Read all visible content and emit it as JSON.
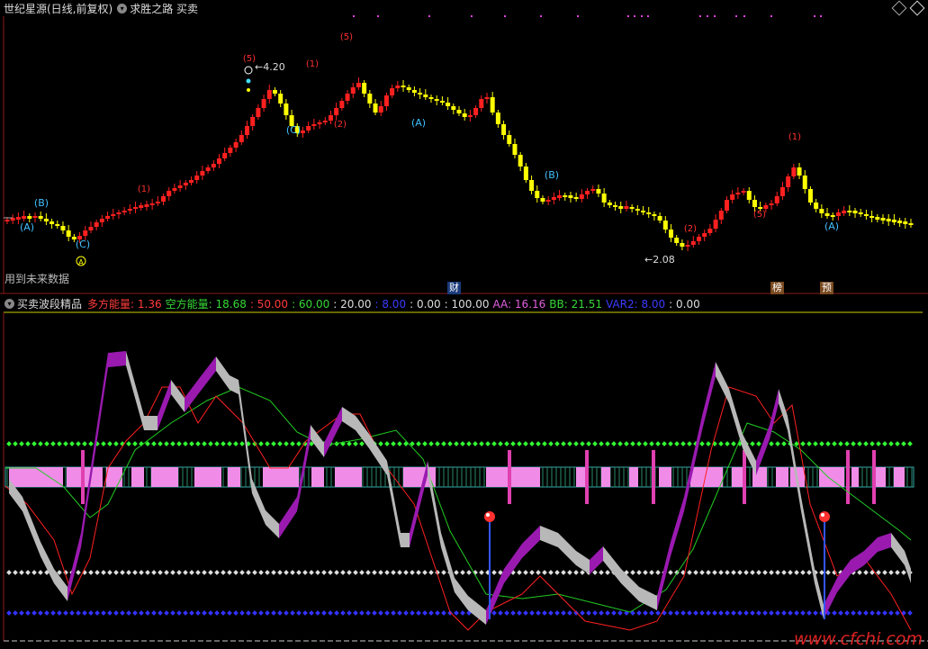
{
  "header": {
    "title": "世纪星源(日线,前复权)",
    "indicator_name": "求胜之路 买卖"
  },
  "price_chart": {
    "high_label": "4.20",
    "low_label": "2.08",
    "future_data_note": "用到未来数据",
    "wave_labels_cyan": [
      "(A)",
      "(B)",
      "(C)",
      "(C)",
      "(A)",
      "(B)",
      "(A)"
    ],
    "wave_labels_red": [
      "(1)",
      "(5)",
      "(1)",
      "(2)",
      "(5)",
      "(1)",
      "(2)",
      "(5)"
    ],
    "event_tags": [
      {
        "text": "财",
        "color": "#1a6fd8"
      },
      {
        "text": "榜",
        "color": "#c58a4a"
      },
      {
        "text": "预",
        "color": "#c58a4a"
      }
    ],
    "a_marker": "A"
  },
  "indicator": {
    "name": "买卖波段精品",
    "items": [
      {
        "label": "多方能量",
        "value": "1.36",
        "color": "#ff3b3b"
      },
      {
        "label": "空方能量",
        "value": "18.68",
        "color": "#36d836"
      },
      {
        "label": "",
        "value": "50.00",
        "color": "#ff3b3b"
      },
      {
        "label": "",
        "value": "60.00",
        "color": "#36d836"
      },
      {
        "label": "",
        "value": "20.00",
        "color": "#dddddd"
      },
      {
        "label": "",
        "value": "8.00",
        "color": "#3b3bff"
      },
      {
        "label": "",
        "value": "0.00",
        "color": "#dddddd"
      },
      {
        "label": "",
        "value": "100.00",
        "color": "#dddddd"
      },
      {
        "label": "AA",
        "value": "16.16",
        "color": "#e060e0"
      },
      {
        "label": "BB",
        "value": "21.51",
        "color": "#36d836"
      },
      {
        "label": "VAR2",
        "value": "8.00",
        "color": "#3b3bff"
      },
      {
        "label": "",
        "value": "0.00",
        "color": "#dddddd"
      }
    ]
  },
  "watermark": "www.cfchi.com"
}
